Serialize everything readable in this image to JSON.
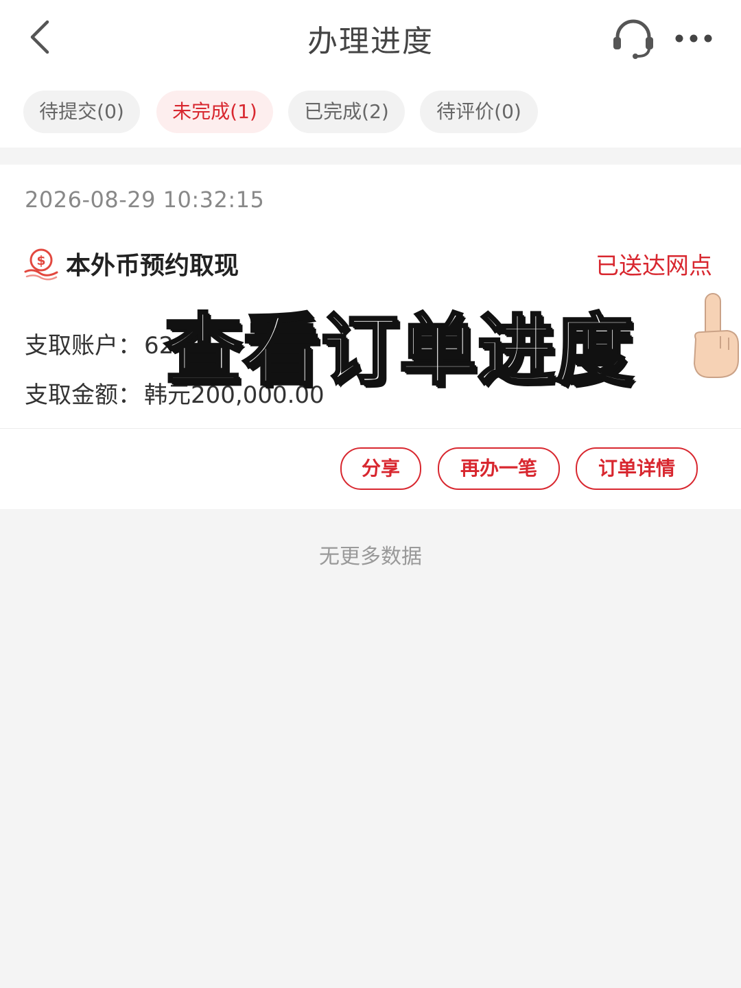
{
  "header": {
    "title": "办理进度",
    "back_icon": "chevron-left-icon",
    "service_icon": "headset-icon",
    "more_icon": "more-dots-icon"
  },
  "tabs": [
    {
      "label": "待提交(0)",
      "active": false
    },
    {
      "label": "未完成(1)",
      "active": true
    },
    {
      "label": "已完成(2)",
      "active": false
    },
    {
      "label": "待评价(0)",
      "active": false
    }
  ],
  "order": {
    "time": "2026-08-29 10:32:15",
    "name": "本外币预约取现",
    "status": "已送达网点",
    "account_label": "支取账户：",
    "account_value": "62",
    "amount_label": "支取金额：",
    "amount_value": "韩元200,000.00",
    "actions": [
      "分享",
      "再办一笔",
      "订单详情"
    ]
  },
  "footer": {
    "no_more": "无更多数据"
  },
  "overlay": {
    "caption": "查看订单进度",
    "hand_icon": "pointing-up-hand-icon"
  },
  "colors": {
    "accent": "#d8272f",
    "tab_active_bg": "#fdeeee",
    "page_bg": "#f4f4f4"
  }
}
